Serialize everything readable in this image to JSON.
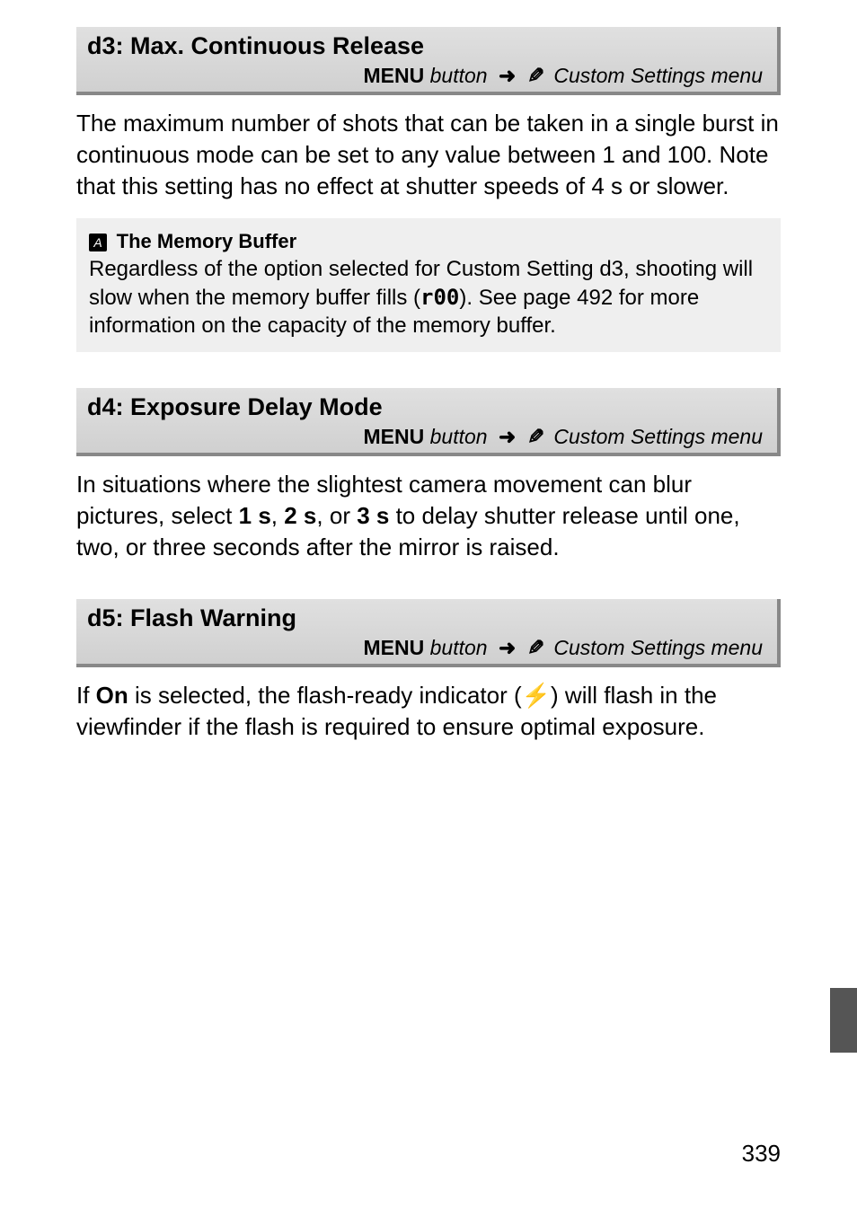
{
  "d3": {
    "title": "d3: Max.  Continuous Release",
    "menu_label": "MENU",
    "button_text": " button",
    "csm_text": " Custom Settings menu",
    "body": "The maximum number of shots that can be taken in a single burst in continuous mode can be set to any value between 1 and 100.  Note that this setting has no effect at shutter speeds of 4 s or slower."
  },
  "note": {
    "title": "The Memory Buffer",
    "text_before": "Regardless of the option selected for Custom Setting d3, shooting will slow when the memory buffer fills (",
    "r00": "r00",
    "text_after": ").  See page 492 for more information on the capacity of the memory buffer."
  },
  "d4": {
    "title": "d4: Exposure Delay Mode",
    "menu_label": "MENU",
    "button_text": " button",
    "csm_text": " Custom Settings menu",
    "body_a": "In situations where the slightest camera movement can blur pictures, select ",
    "opt1": "1 s",
    "sep1": ", ",
    "opt2": "2 s",
    "sep2": ", or ",
    "opt3": "3 s",
    "body_b": " to delay shutter release until one, two, or three seconds after the mirror is raised."
  },
  "d5": {
    "title": "d5: Flash Warning",
    "menu_label": "MENU",
    "button_text": " button",
    "csm_text": " Custom Settings menu",
    "body_a": "If ",
    "on": "On",
    "body_b": " is selected, the flash-ready indicator (",
    "flash": "⚡",
    "body_c": ") will flash in the viewfinder if the flash is required to ensure optimal exposure."
  },
  "page_number": "339"
}
